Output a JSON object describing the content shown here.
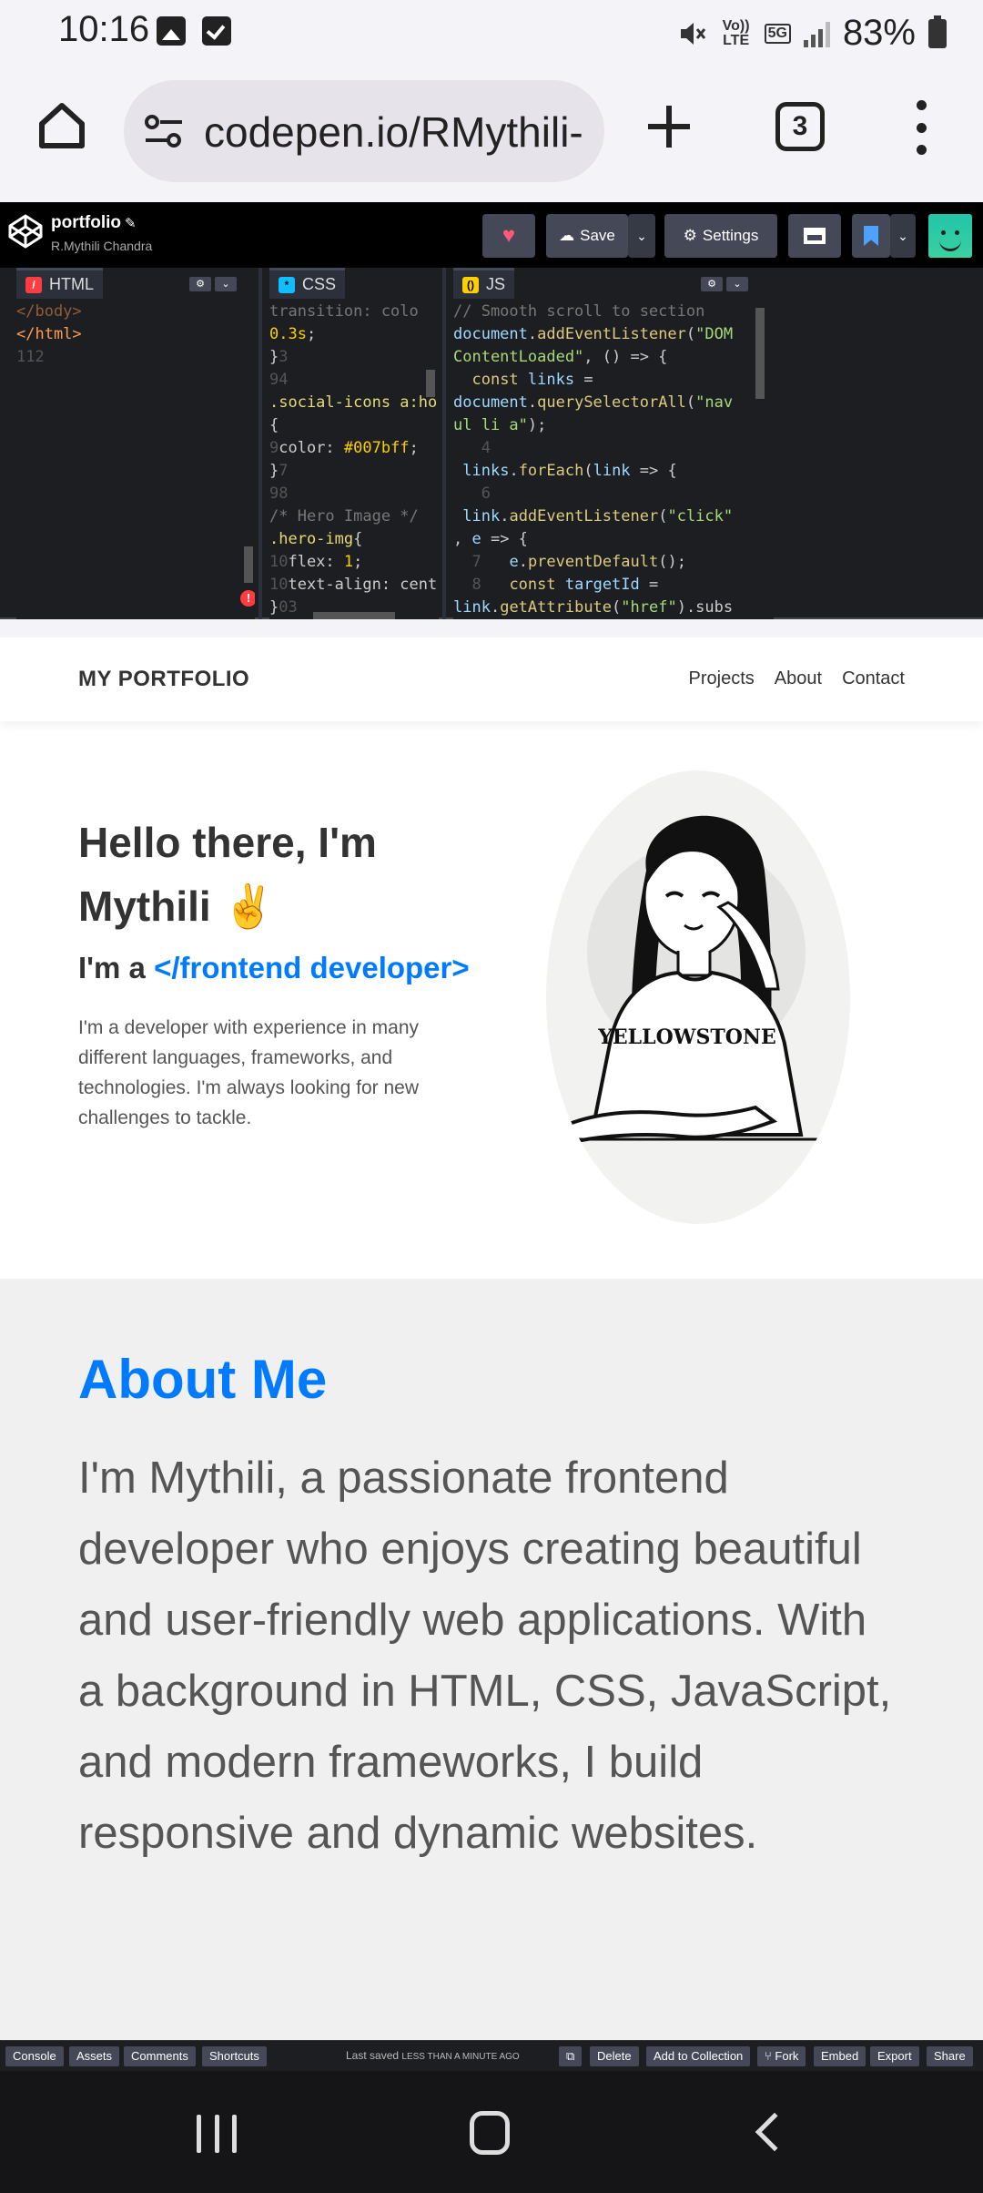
{
  "status_bar": {
    "time": "10:16",
    "volte_label": "Vo)) LTE",
    "network_label": "5G",
    "battery": "83%"
  },
  "browser": {
    "url": "codepen.io/RMythili-",
    "tab_count": "3"
  },
  "codepen": {
    "title": "portfolio",
    "author": "R.Mythili Chandra",
    "save_label": "Save",
    "settings_label": "Settings",
    "panes": {
      "html_label": "HTML",
      "css_label": "CSS",
      "js_label": "JS"
    },
    "error_mark": "!",
    "footer": {
      "console": "Console",
      "assets": "Assets",
      "comments": "Comments",
      "shortcuts": "Shortcuts",
      "last_saved_prefix": "Last saved",
      "last_saved_time": "LESS THAN A MINUTE AGO",
      "delete": "Delete",
      "add_to_collection": "Add to Collection",
      "fork": "Fork",
      "embed": "Embed",
      "export": "Export",
      "share": "Share"
    }
  },
  "site": {
    "logo": "MY PORTFOLIO",
    "nav": {
      "projects": "Projects",
      "about": "About",
      "contact": "Contact"
    },
    "hero": {
      "greeting": "Hello there, I'm Mythili ✌️",
      "role_prefix": "I'm a ",
      "role": "</frontend developer>",
      "description": "I'm a developer with experience in many different languages, frameworks, and technologies. I'm always looking for new challenges to tackle.",
      "shirt_text": "YELLOWSTONE"
    },
    "about": {
      "title": "About Me",
      "text": "I'm Mythili, a passionate frontend developer who enjoys creating beautiful and user-friendly web applications. With a background in HTML, CSS, JavaScript, and modern frameworks, I build responsive and dynamic websites."
    }
  },
  "colors": {
    "accent": "#007bff",
    "codepen_bg": "#000000",
    "editor_bg": "#1d1e22"
  }
}
